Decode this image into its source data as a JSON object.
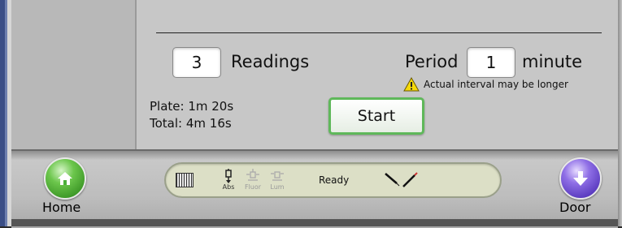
{
  "readings": {
    "value": "3",
    "label": "Readings"
  },
  "period": {
    "label": "Period",
    "value": "1",
    "unit": "minute"
  },
  "warning": {
    "text": "Actual interval may be longer",
    "icon": "warning-icon"
  },
  "timing": {
    "plate": "Plate: 1m 20s",
    "total": "Total: 4m 16s"
  },
  "start_button": {
    "label": "Start"
  },
  "bottom_bar": {
    "home_label": "Home",
    "door_label": "Door",
    "status": {
      "modes": [
        "Abs",
        "Fluor",
        "Lum"
      ],
      "active_mode": "Abs",
      "state": "Ready"
    }
  },
  "colors": {
    "start_border": "#5fb85a",
    "home_button": "#4caf3a",
    "door_button": "#6a4ad0",
    "status_pill": "#dcdfc6"
  }
}
